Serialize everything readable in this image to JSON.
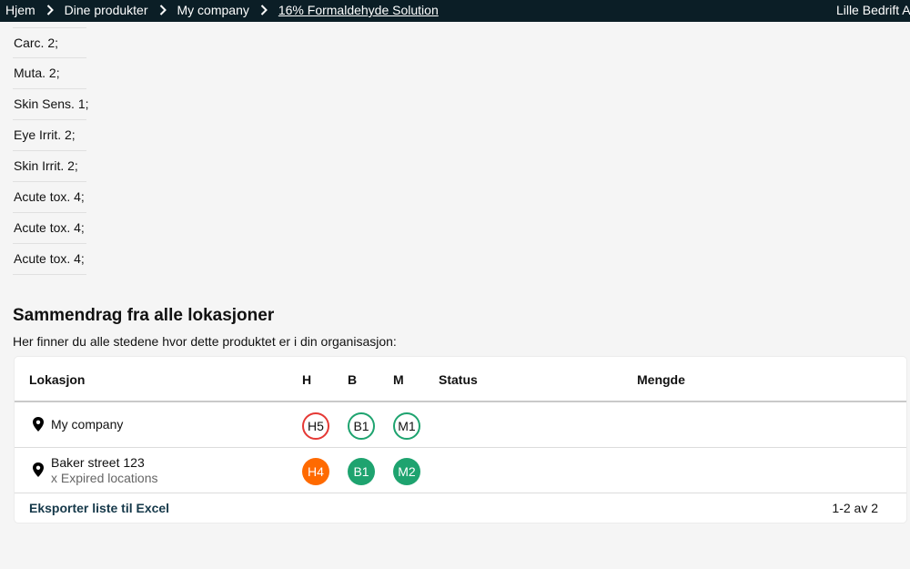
{
  "breadcrumb": {
    "items": [
      "Hjem",
      "Dine produkter",
      "My company",
      "16% Formaldehyde Solution"
    ],
    "organization": "Lille Bedrift AS"
  },
  "hazards": [
    "Carc. 2;",
    "Muta. 2;",
    "Skin Sens. 1;",
    "Eye Irrit. 2;",
    "Skin Irrit. 2;",
    "Acute tox. 4;",
    "Acute tox. 4;",
    "Acute tox. 4;"
  ],
  "summary": {
    "title": "Sammendrag fra alle lokasjoner",
    "subtitle": "Her finner du alle stedene hvor dette produktet er i din organisasjon:"
  },
  "table": {
    "headers": {
      "location": "Lokasjon",
      "h": "H",
      "b": "B",
      "m": "M",
      "status": "Status",
      "amount": "Mengde"
    },
    "rows": [
      {
        "name": "My company",
        "sub": "",
        "h": "H5",
        "b": "B1",
        "m": "M1"
      },
      {
        "name": "Baker street 123",
        "sub": "x Expired locations",
        "h": "H4",
        "b": "B1",
        "m": "M2"
      }
    ],
    "export_label": "Eksporter liste til Excel",
    "pagination": "1-2 av 2"
  },
  "icons": {
    "chevron": "chevron-right-icon",
    "location": "location-pin-icon"
  },
  "colors": {
    "topbar": "#0b1e26",
    "badge_red": "#e53935",
    "badge_orange": "#ff6a00",
    "badge_green": "#1ea36f"
  }
}
